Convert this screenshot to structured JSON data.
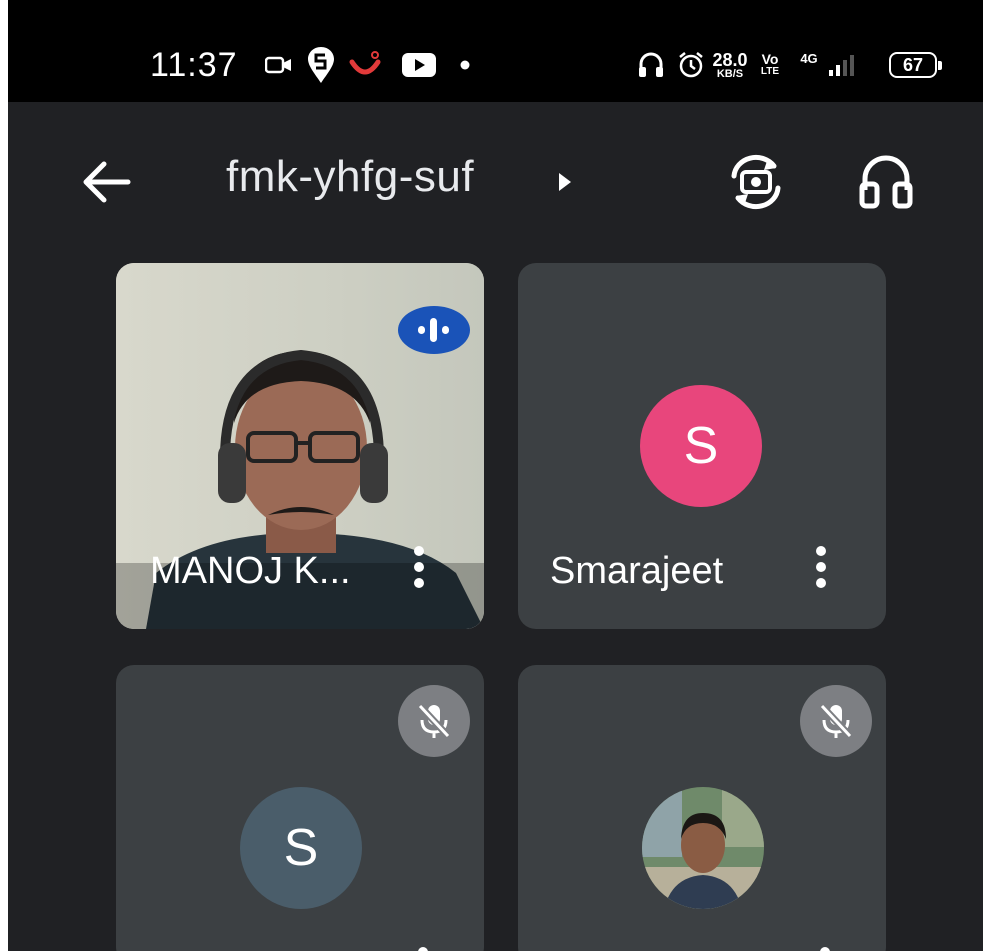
{
  "status_bar": {
    "time": "11:37",
    "net_speed_value": "28.0",
    "net_speed_unit": "KB/S",
    "volte_top": "Vo",
    "volte_bottom": "LTE",
    "network": "4G",
    "battery": "67",
    "notification_icons": [
      "video-camera-icon",
      "swiggy-icon",
      "app-icon",
      "youtube-icon",
      "dot-icon"
    ],
    "system_icons": [
      "headset-icon",
      "alarm-icon",
      "signal-icon",
      "battery-icon"
    ]
  },
  "toolbar": {
    "back_icon": "arrow-left-icon",
    "meeting_code": "fmk-yhfg-suf",
    "expand_icon": "caret-right-icon",
    "switch_camera_icon": "switch-camera-icon",
    "audio_output_icon": "headphones-icon"
  },
  "participants": [
    {
      "name": "MANOJ K...",
      "type": "video",
      "speaking": true
    },
    {
      "name": "Smarajeet",
      "type": "avatar",
      "initial": "S",
      "avatar_color": "#e8467c"
    },
    {
      "name": "",
      "type": "avatar",
      "initial": "S",
      "avatar_color": "#4a5d6a",
      "muted": true
    },
    {
      "name": "",
      "type": "photo",
      "muted": true
    }
  ],
  "colors": {
    "background": "#202124",
    "tile": "#3c4043",
    "speaking_badge": "#1a53b8",
    "muted_badge": "#7d7f83"
  }
}
